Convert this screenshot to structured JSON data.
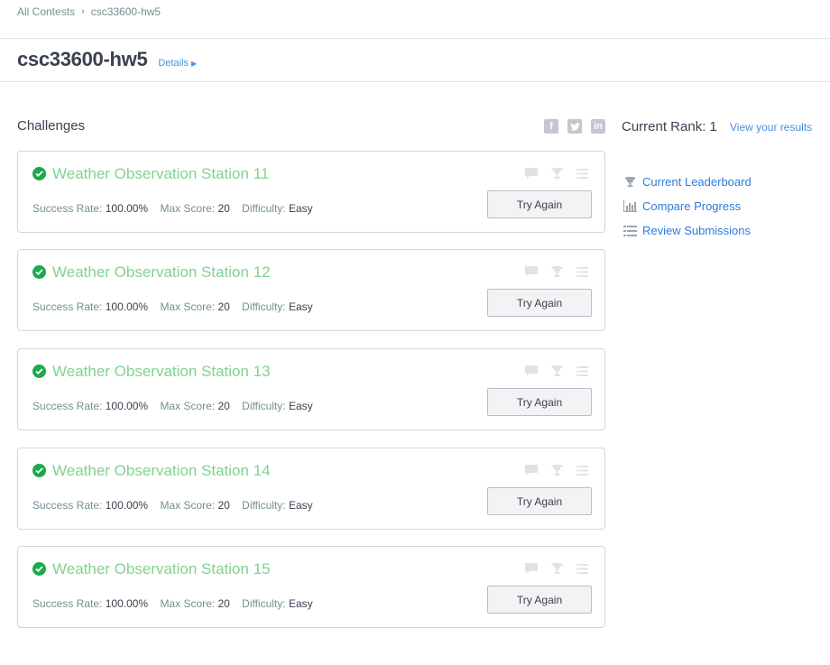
{
  "breadcrumb": {
    "root": "All Contests",
    "current": "csc33600-hw5"
  },
  "contest": {
    "title": "csc33600-hw5",
    "details_label": "Details"
  },
  "challenges_heading": "Challenges",
  "social": {
    "facebook": "f",
    "twitter": "t",
    "linkedin": "in"
  },
  "rank": {
    "label": "Current Rank:",
    "value": "1",
    "view_results": "View your results"
  },
  "side_links": {
    "leaderboard": "Current Leaderboard",
    "compare": "Compare Progress",
    "review": "Review Submissions"
  },
  "meta_labels": {
    "success": "Success Rate:",
    "max": "Max Score:",
    "difficulty": "Difficulty:"
  },
  "challenges": [
    {
      "name": "Weather Observation Station 11",
      "success_rate": "100.00%",
      "max_score": "20",
      "difficulty": "Easy",
      "button": "Try Again"
    },
    {
      "name": "Weather Observation Station 12",
      "success_rate": "100.00%",
      "max_score": "20",
      "difficulty": "Easy",
      "button": "Try Again"
    },
    {
      "name": "Weather Observation Station 13",
      "success_rate": "100.00%",
      "max_score": "20",
      "difficulty": "Easy",
      "button": "Try Again"
    },
    {
      "name": "Weather Observation Station 14",
      "success_rate": "100.00%",
      "max_score": "20",
      "difficulty": "Easy",
      "button": "Try Again"
    },
    {
      "name": "Weather Observation Station 15",
      "success_rate": "100.00%",
      "max_score": "20",
      "difficulty": "Easy",
      "button": "Try Again"
    }
  ],
  "colors": {
    "solved_green": "#1ba94c",
    "challenge_name": "#7fd38f",
    "link_blue": "#2f7bd9"
  },
  "icons": {
    "solved": "check-circle-icon",
    "discussion": "comment-icon",
    "leaderboard": "trophy-icon",
    "submissions": "list-icon"
  }
}
